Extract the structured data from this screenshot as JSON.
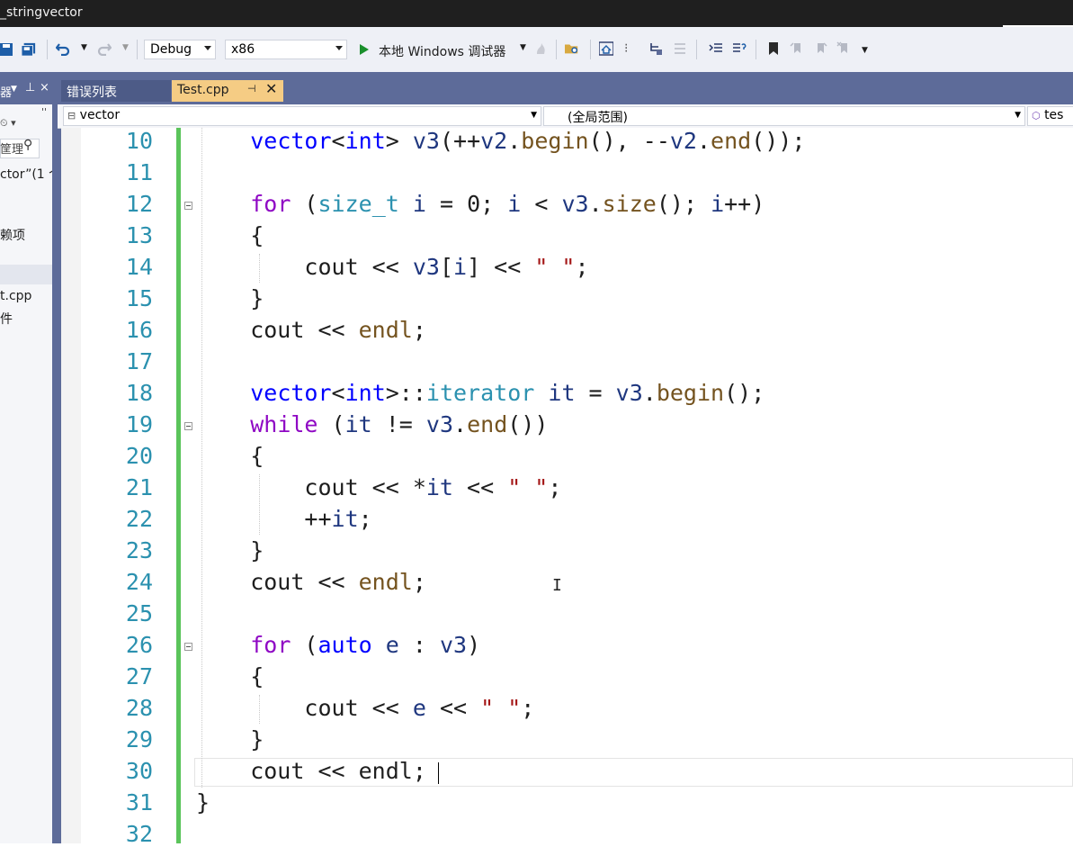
{
  "titlebar": {
    "title": "_stringvector"
  },
  "toolbar": {
    "config": "Debug",
    "platform": "x86",
    "debugger_label": "本地 Windows 调试器"
  },
  "left_panel": {
    "header_glyph": "器",
    "items": [
      "筐理",
      "ctor”(1 个",
      "赖项",
      "t.cpp",
      "件"
    ]
  },
  "tabs": [
    {
      "label": "错误列表",
      "active": false
    },
    {
      "label": "Test.cpp",
      "active": true
    }
  ],
  "navbar": {
    "project": "vector",
    "scope": "(全局范围)",
    "member": "tes"
  },
  "editor": {
    "line_numbers": [
      "10",
      "11",
      "12",
      "13",
      "14",
      "15",
      "16",
      "17",
      "18",
      "19",
      "20",
      "21",
      "22",
      "23",
      "24",
      "25",
      "26",
      "27",
      "28",
      "29",
      "30",
      "31",
      "32"
    ]
  }
}
